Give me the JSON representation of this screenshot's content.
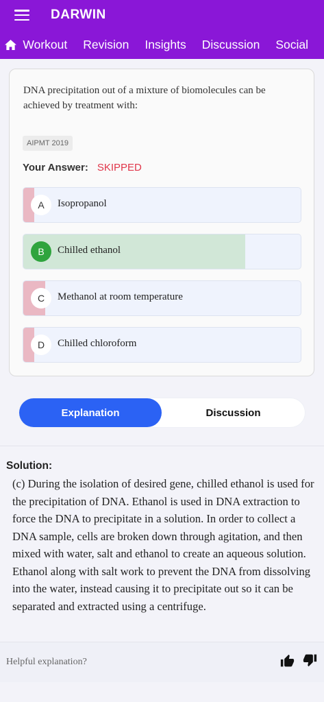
{
  "app": {
    "title": "DARWIN",
    "nav": [
      "Workout",
      "Revision",
      "Insights",
      "Discussion",
      "Social"
    ]
  },
  "question": {
    "text": "DNA precipitation out of a mixture of biomolecules can be achieved by treatment with:",
    "tag": "AIPMT 2019",
    "answer_label": "Your Answer:",
    "answer_value": "SKIPPED",
    "options": [
      {
        "letter": "A",
        "label": "Isopropanol",
        "share": 0.04,
        "correct": false
      },
      {
        "letter": "B",
        "label": "Chilled ethanol",
        "share": 0.8,
        "correct": true
      },
      {
        "letter": "C",
        "label": "Methanol at room temperature",
        "share": 0.08,
        "correct": false
      },
      {
        "letter": "D",
        "label": "Chilled chloroform",
        "share": 0.04,
        "correct": false
      }
    ]
  },
  "tabs": {
    "explanation": "Explanation",
    "discussion": "Discussion"
  },
  "solution": {
    "title": "Solution:",
    "text": "(c) During the isolation of desired gene, chilled ethanol is used for the precipitation of DNA. Ethanol is used in DNA extraction to force the DNA to precipitate in a solution. In order to collect a DNA sample, cells are broken down through agitation, and then mixed with water, salt and ethanol to create an aqueous solution. Ethanol along with salt work to prevent the DNA from dissolving into the water, instead causing it to precipitate out so it can be separated and extracted using a centrifuge."
  },
  "feedback": {
    "prompt": "Helpful explanation?"
  },
  "colors": {
    "brand": "#8a17d7",
    "accent": "#2b62f4",
    "correct": "#2fa43d",
    "skipped": "#e0364a"
  },
  "icons": {
    "menu": "hamburger-menu-icon",
    "home": "home-icon",
    "like": "thumbs-up-icon",
    "dislike": "thumbs-down-icon"
  }
}
